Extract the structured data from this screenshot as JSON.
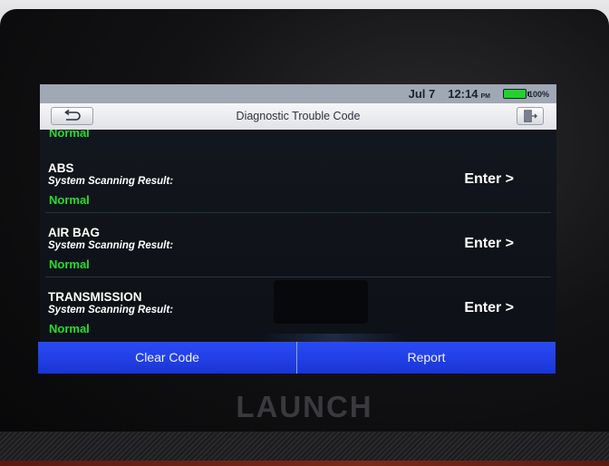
{
  "status_bar": {
    "date": "Jul 7",
    "time": "12:14",
    "ampm": "PM",
    "battery_percent": "100%",
    "battery_color": "#23d12c"
  },
  "title_bar": {
    "title": "Diagnostic Trouble Code",
    "back_icon": "back-arrow-icon",
    "exit_icon": "exit-icon"
  },
  "list": {
    "top_partial_result": "Normal",
    "entries": [
      {
        "name": "ABS",
        "subtitle": "System Scanning Result:",
        "result": "Normal",
        "action": "Enter >"
      },
      {
        "name": "AIR BAG",
        "subtitle": "System Scanning Result:",
        "result": "Normal",
        "action": "Enter >"
      },
      {
        "name": "TRANSMISSION",
        "subtitle": "System Scanning Result:",
        "result": "Normal",
        "action": "Enter >"
      }
    ],
    "result_color": "#22e02a"
  },
  "bottom_bar": {
    "clear_label": "Clear Code",
    "report_label": "Report",
    "accent": "#1e3ad8"
  },
  "device": {
    "brand": "LAUNCH"
  }
}
